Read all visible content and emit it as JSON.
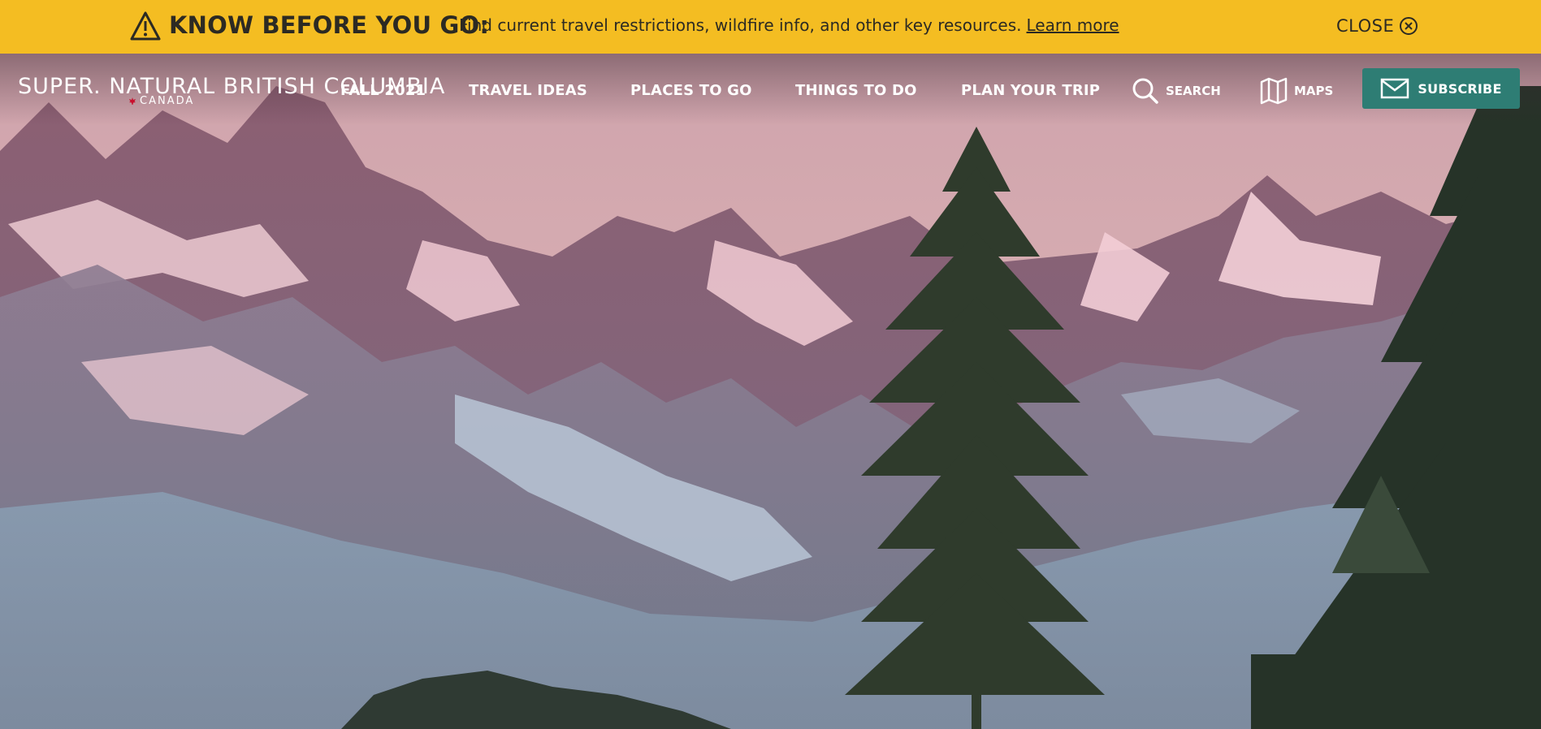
{
  "alert": {
    "heading": "KNOW BEFORE YOU GO:",
    "message": "Find current travel restrictions, wildfire info, and other key resources.",
    "link_label": "Learn more",
    "close_label": "CLOSE",
    "icon": "warning-icon",
    "background_color": "#f4bd22"
  },
  "logo": {
    "main": "SUPER. NATURAL BRITISH COLUMBIA",
    "sub": "CANADA"
  },
  "nav": {
    "items": [
      {
        "label": "FALL 2021"
      },
      {
        "label": "TRAVEL IDEAS"
      },
      {
        "label": "PLACES TO GO"
      },
      {
        "label": "THINGS TO DO"
      },
      {
        "label": "PLAN YOUR TRIP"
      }
    ],
    "search_label": "SEARCH",
    "maps_label": "MAPS",
    "subscribe_label": "SUBSCRIBE",
    "subscribe_color": "#2e7d74"
  }
}
